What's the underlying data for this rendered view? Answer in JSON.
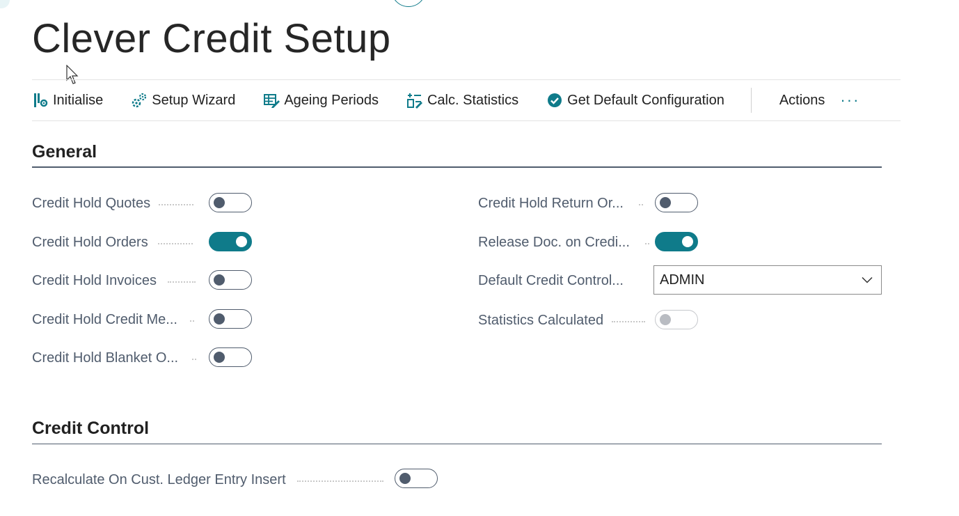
{
  "page": {
    "title": "Clever Credit Setup"
  },
  "actions": [
    {
      "label": "Initialise",
      "icon": "wrench-gear-icon"
    },
    {
      "label": "Setup Wizard",
      "icon": "wizard-gears-icon"
    },
    {
      "label": "Ageing Periods",
      "icon": "table-edit-icon"
    },
    {
      "label": "Calc. Statistics",
      "icon": "calc-list-icon"
    },
    {
      "label": "Get Default Configuration",
      "icon": "check-circle-icon"
    }
  ],
  "actions_menu": {
    "label": "Actions",
    "more": "···"
  },
  "sections": {
    "general": {
      "title": "General"
    },
    "credit_control": {
      "title": "Credit Control"
    }
  },
  "general_left": [
    {
      "label": "Credit Hold Quotes",
      "value": false
    },
    {
      "label": "Credit Hold Orders",
      "value": true
    },
    {
      "label": "Credit Hold Invoices",
      "value": false
    },
    {
      "label": "Credit Hold Credit Me...",
      "value": false
    },
    {
      "label": "Credit Hold Blanket O...",
      "value": false
    }
  ],
  "general_right": [
    {
      "label": "Credit Hold Return Or...",
      "value": false
    },
    {
      "label": "Release Doc. on Credi...",
      "value": true
    },
    {
      "label": "Default Credit Control...",
      "value": "ADMIN"
    },
    {
      "label": "Statistics Calculated",
      "value": false,
      "disabled": true
    }
  ],
  "credit_control": [
    {
      "label": "Recalculate On Cust. Ledger Entry Insert",
      "value": false
    }
  ],
  "colors": {
    "accent": "#0f7b8a",
    "label": "#505c6d",
    "text": "#212121"
  }
}
